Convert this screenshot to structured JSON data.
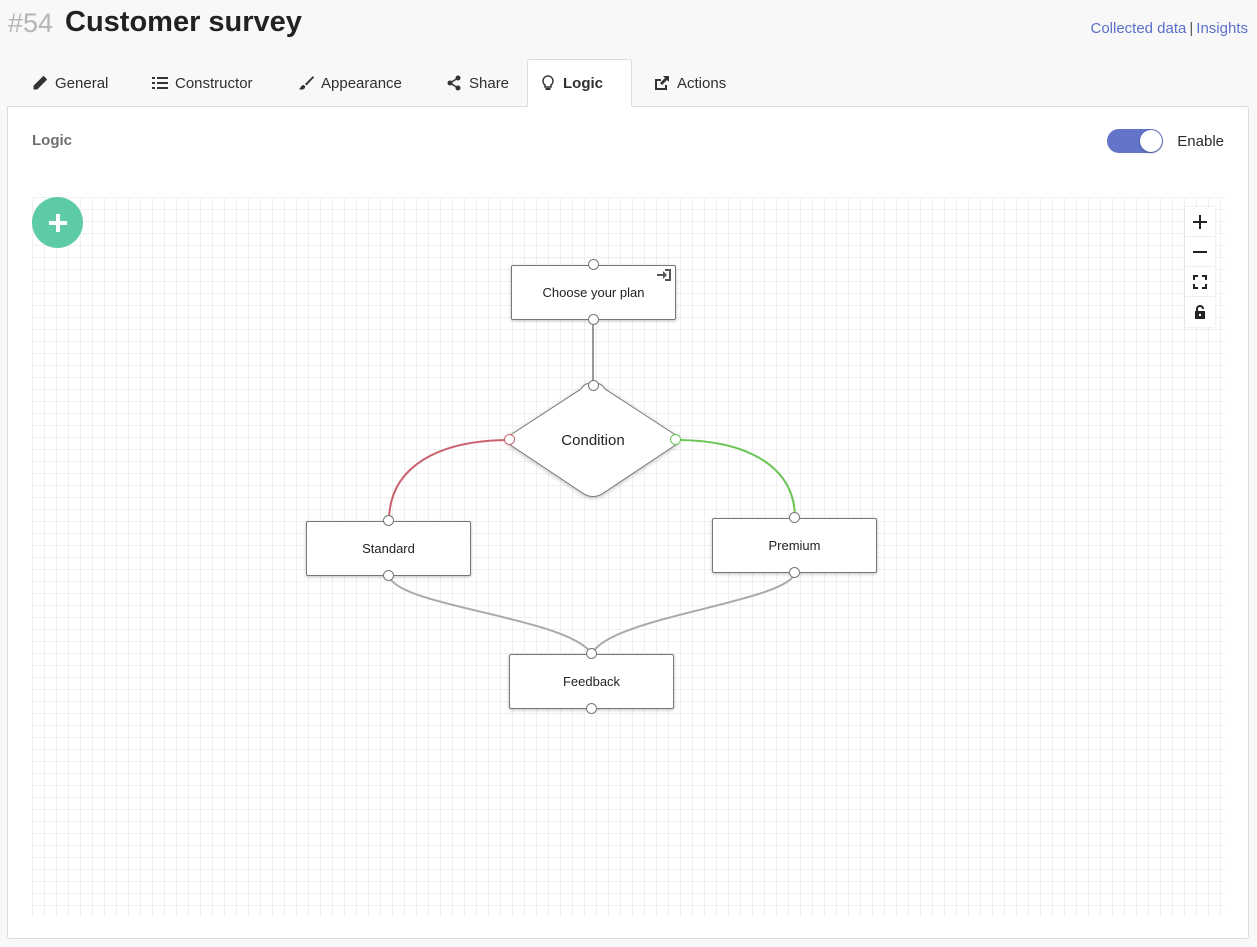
{
  "header": {
    "form_id": "#54",
    "form_title": "Customer survey",
    "link_collected": "Collected data",
    "separator": "|",
    "link_insights": "Insights"
  },
  "tabs": [
    {
      "label": "General",
      "icon": "pencil-icon"
    },
    {
      "label": "Constructor",
      "icon": "list-icon"
    },
    {
      "label": "Appearance",
      "icon": "brush-icon"
    },
    {
      "label": "Share",
      "icon": "share-icon"
    },
    {
      "label": "Logic",
      "icon": "lightbulb-icon",
      "active": true
    },
    {
      "label": "Actions",
      "icon": "external-link-icon"
    }
  ],
  "panel": {
    "title": "Logic",
    "toggle_label": "Enable",
    "toggle_on": true
  },
  "diagram": {
    "nodes": {
      "start": "Choose your plan",
      "condition": "Condition",
      "left": "Standard",
      "right": "Premium",
      "end": "Feedback"
    },
    "edges": [
      {
        "from": "Choose your plan",
        "to": "Condition"
      },
      {
        "from": "Condition",
        "to": "Standard",
        "branch": "false"
      },
      {
        "from": "Condition",
        "to": "Premium",
        "branch": "true"
      },
      {
        "from": "Standard",
        "to": "Feedback"
      },
      {
        "from": "Premium",
        "to": "Feedback"
      }
    ]
  },
  "zoom_controls": [
    "zoom-in-icon",
    "zoom-out-icon",
    "fit-screen-icon",
    "lock-icon"
  ],
  "colors": {
    "accent": "#6374c9",
    "add_button": "#5ecba7",
    "branch_false": "#c9636d",
    "branch_true": "#6cc657",
    "link": "#5a70c7"
  }
}
